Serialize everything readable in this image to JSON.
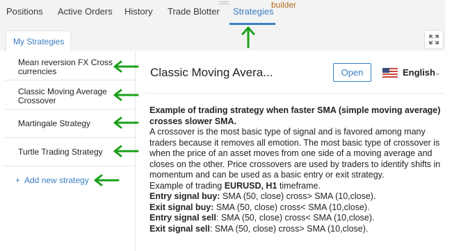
{
  "tabs": [
    {
      "label": "Positions"
    },
    {
      "label": "Active Orders"
    },
    {
      "label": "History"
    },
    {
      "label": "Trade Blotter"
    },
    {
      "label": "Strategies",
      "active": true
    }
  ],
  "builder_label": "builder",
  "my_strategies_tab": "My Strategies",
  "sidebar": {
    "items": [
      {
        "label_line1": "Mean reversion FX Cross",
        "label_line2": "currencies"
      },
      {
        "label_line1": "Classic Moving Average",
        "label_line2": "Crossover"
      },
      {
        "label_line1": "Martingale Strategy",
        "label_line2": ""
      },
      {
        "label_line1": "Turtle Trading Strategy",
        "label_line2": ""
      }
    ],
    "add_new": "Add new strategy"
  },
  "main": {
    "title": "Classic Moving Avera...",
    "open_button": "Open",
    "language": "English",
    "heading": "Example of trading strategy when faster SMA (simple moving average) crosses slower SMA.",
    "body": "A crossover is the most basic type of signal and is favored among many traders because it removes all emotion. The most basic type of crossover is when the price of an asset moves from one side of a moving average and closes on the other. Price crossovers are used by traders to identify shifts in momentum and can be used as a basic entry or exit strategy.",
    "example_prefix": "Example of trading ",
    "example_pair": "EURUSD, H1",
    "example_suffix": " timeframe.",
    "signals": [
      {
        "label": "Entry signal buy:",
        "text": " SMA (50, close) cross> SMA (10,close)."
      },
      {
        "label": "Exit signal buy:",
        "text": " SMA (50, close) cross< SMA (10,close)."
      },
      {
        "label": "Entry signal sell",
        "text": ": SMA (50, close) cross< SMA (10,close)."
      },
      {
        "label": "Exit signal sell",
        "text": ": SMA (50, close) cross> SMA (10,close)."
      }
    ]
  },
  "colors": {
    "accent": "#3a7fc1",
    "annotation_arrow": "#1aa01a",
    "builder_text": "#b46a1e"
  }
}
